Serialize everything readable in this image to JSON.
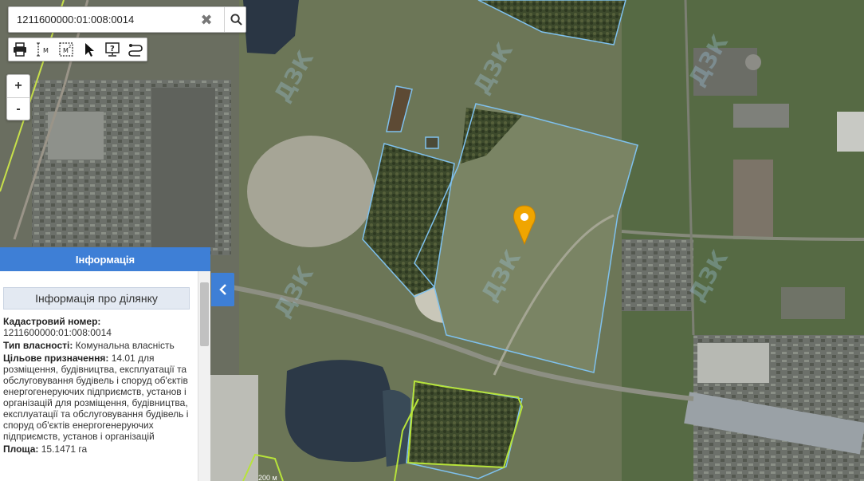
{
  "search": {
    "value": "1211600000:01:008:0014"
  },
  "toolbar": {
    "tools": [
      {
        "name": "print-icon"
      },
      {
        "name": "measure-distance-icon"
      },
      {
        "name": "measure-area-icon"
      },
      {
        "name": "select-cursor-icon"
      },
      {
        "name": "info-identify-icon"
      },
      {
        "name": "route-icon"
      }
    ]
  },
  "zoom": {
    "in_label": "+",
    "out_label": "-"
  },
  "panel": {
    "header": "Інформація",
    "subtitle": "Інформація про ділянку",
    "cadastral_label": "Кадастровий номер:",
    "cadastral_value": "1211600000:01:008:0014",
    "ownership_label": "Тип власності:",
    "ownership_value": "Комунальна власність",
    "purpose_label": "Цільове призначення:",
    "purpose_value": "14.01 для розміщення, будівництва, експлуатації та обслуговування будівель і споруд об'єктів енергогенеруючих підприємств, установ і організацій для розміщення, будівництва, експлуатації та обслуговування будівель і споруд об'єктів енергогенеруючих підприємств, установ і організацій",
    "area_label": "Площа:",
    "area_value": "15.1471 га"
  },
  "scale": {
    "label": "200 м"
  },
  "colors": {
    "accent": "#3e7fd6",
    "parcel_outline": "#7fc1ee",
    "green_outline": "#b7e33a",
    "marker": "#f0a500"
  }
}
